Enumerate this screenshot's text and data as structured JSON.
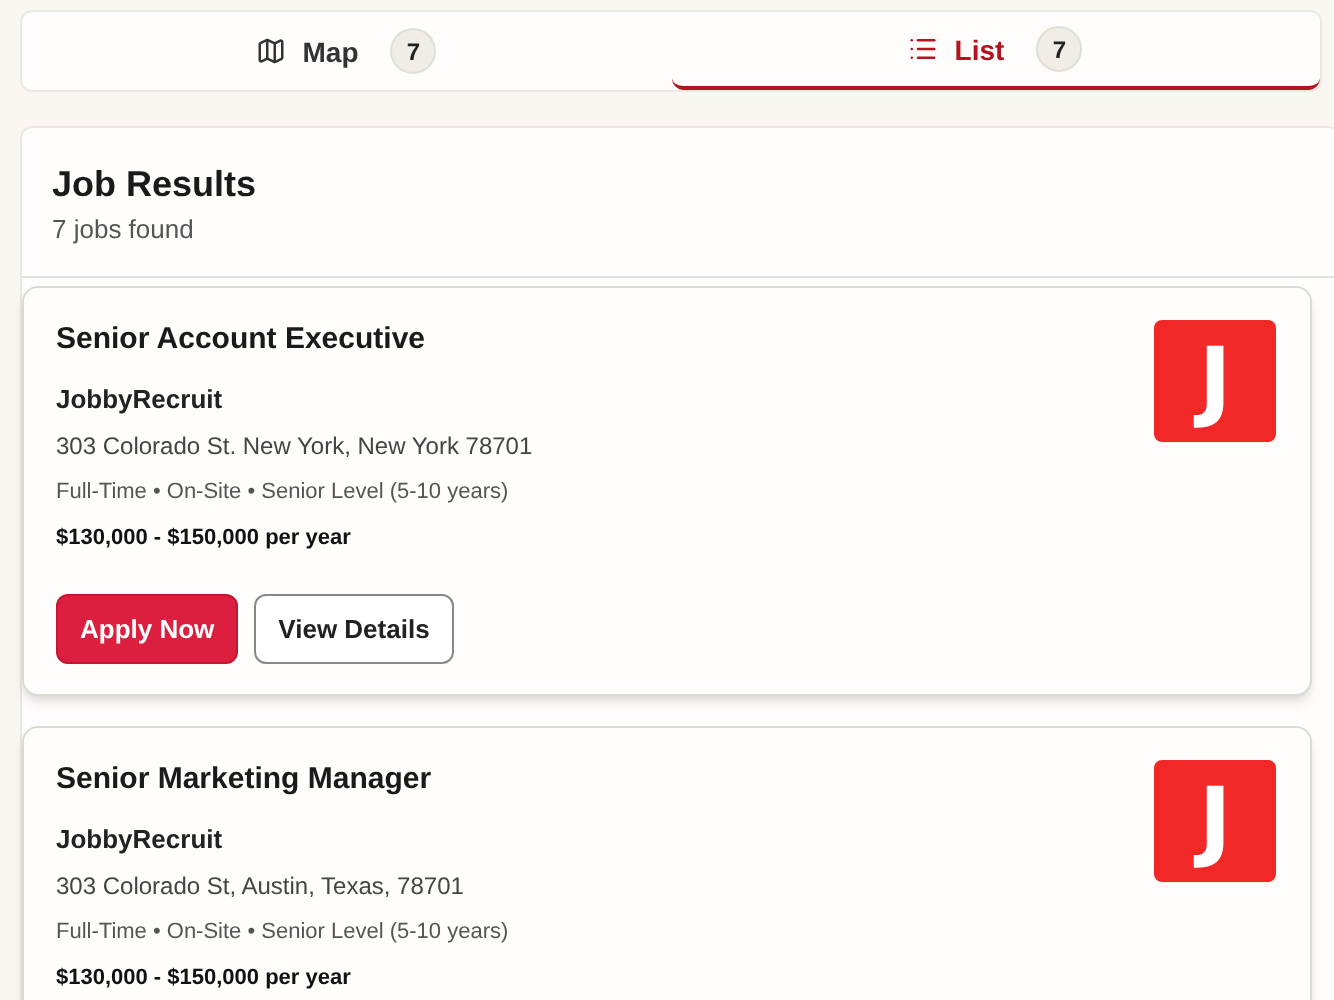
{
  "tabs": [
    {
      "kind": "map",
      "label": "Map",
      "count": "7",
      "selected": false
    },
    {
      "kind": "list",
      "label": "List",
      "count": "7",
      "selected": true
    }
  ],
  "results": {
    "title": "Job Results",
    "subtitle": "7 jobs found"
  },
  "jobs": [
    {
      "title": "Senior Account Executive",
      "company": "JobbyRecruit",
      "address": "303 Colorado St. New York, New York 78701",
      "details": "Full-Time • On-Site • Senior Level (5-10 years)",
      "salary": "$130,000 - $150,000 per year",
      "logo_letter": "J",
      "buttons": [
        "Apply Now",
        "View Details"
      ]
    },
    {
      "title": "Senior Marketing Manager",
      "company": "JobbyRecruit",
      "address": "303 Colorado St, Austin, Texas, 78701",
      "details": "Full-Time • On-Site • Senior Level (5-10 years)",
      "salary": "$130,000 - $150,000 per year",
      "logo_letter": "J"
    }
  ]
}
